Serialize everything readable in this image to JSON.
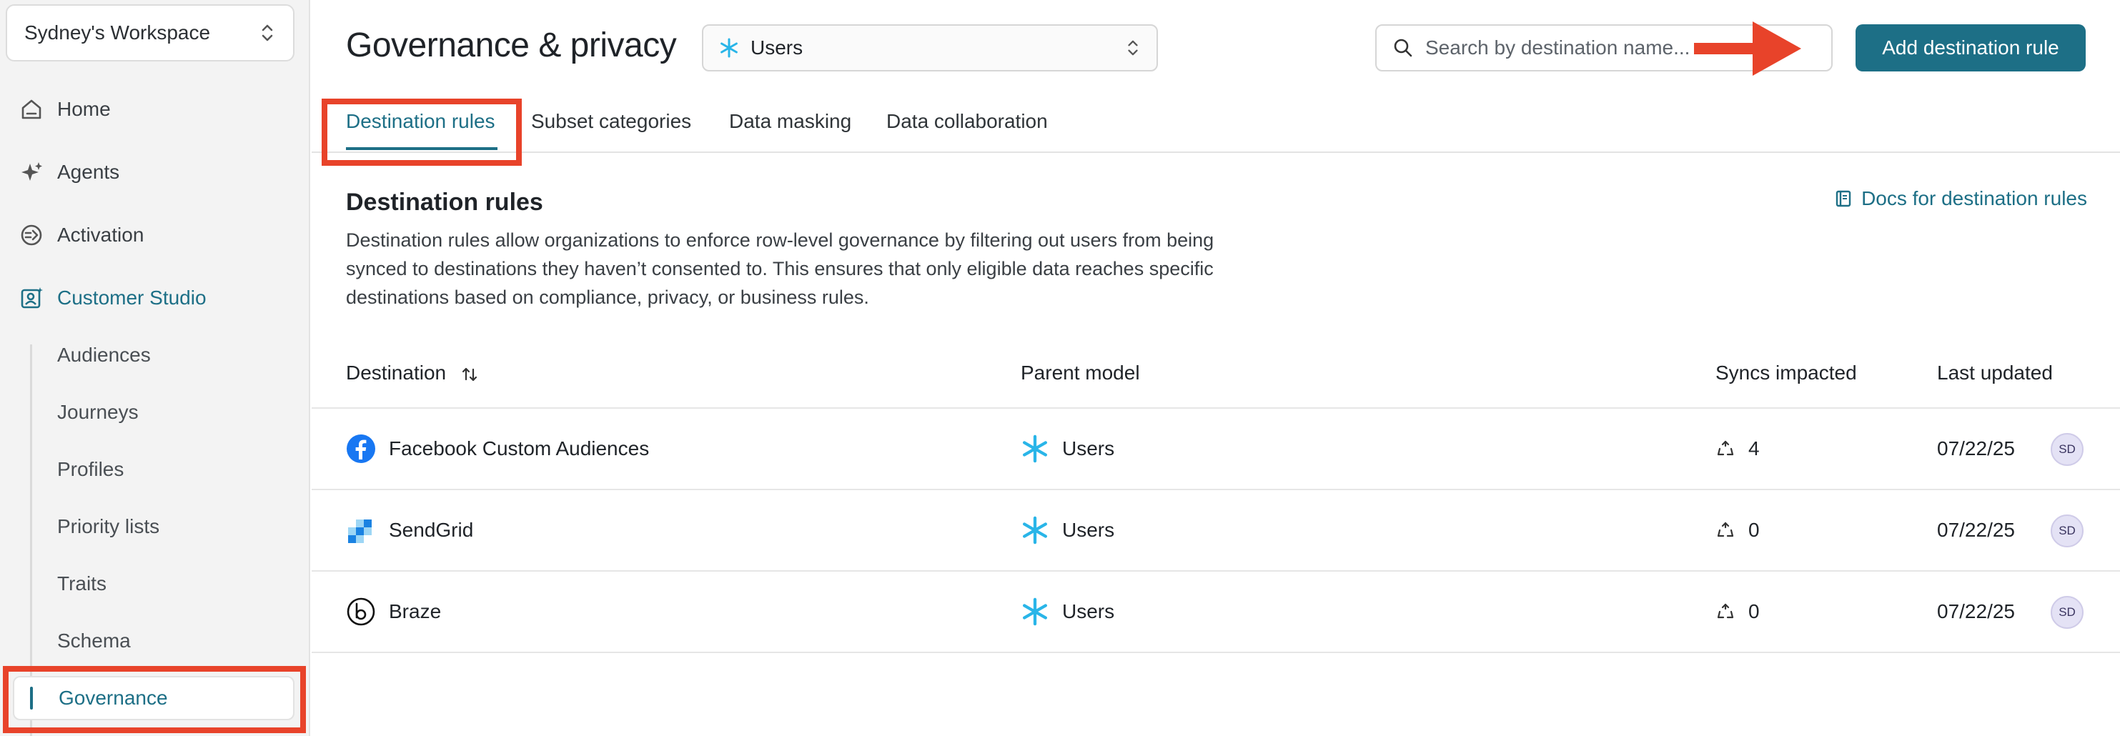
{
  "sidebar": {
    "workspace": "Sydney's Workspace",
    "nav": [
      {
        "label": "Home",
        "icon": "home-icon"
      },
      {
        "label": "Agents",
        "icon": "sparkle-icon"
      },
      {
        "label": "Activation",
        "icon": "activation-icon"
      },
      {
        "label": "Customer Studio",
        "icon": "contact-icon",
        "active": true
      }
    ],
    "sub_items": [
      "Audiences",
      "Journeys",
      "Profiles",
      "Priority lists",
      "Traits",
      "Schema"
    ],
    "governance_label": "Governance"
  },
  "header": {
    "title": "Governance & privacy",
    "model_select": {
      "value": "Users",
      "icon": "snowflake-icon"
    },
    "search_placeholder": "Search by destination name...",
    "add_button": "Add destination rule"
  },
  "tabs": [
    {
      "label": "Destination rules",
      "active": true
    },
    {
      "label": "Subset categories"
    },
    {
      "label": "Data masking"
    },
    {
      "label": "Data collaboration"
    }
  ],
  "section": {
    "title": "Destination rules",
    "docs_link": "Docs for destination rules",
    "description_lines": [
      "Destination rules allow organizations to enforce row-level governance by filtering out users from being",
      "synced to destinations they haven’t consented to. This ensures that only eligible data reaches specific",
      "destinations based on compliance, privacy, or business rules."
    ]
  },
  "table": {
    "columns": [
      "Destination",
      "Parent model",
      "Syncs impacted",
      "Last updated"
    ],
    "rows": [
      {
        "destination": "Facebook Custom Audiences",
        "icon": "facebook-icon",
        "parent_model": "Users",
        "syncs": "4",
        "updated": "07/22/25",
        "avatar": "SD"
      },
      {
        "destination": "SendGrid",
        "icon": "sendgrid-icon",
        "parent_model": "Users",
        "syncs": "0",
        "updated": "07/22/25",
        "avatar": "SD"
      },
      {
        "destination": "Braze",
        "icon": "braze-icon",
        "parent_model": "Users",
        "syncs": "0",
        "updated": "07/22/25",
        "avatar": "SD"
      }
    ]
  },
  "colors": {
    "accent": "#1d6f86",
    "highlight": "#e8432a",
    "snowflake": "#29b5e8",
    "facebook": "#1877f2"
  }
}
